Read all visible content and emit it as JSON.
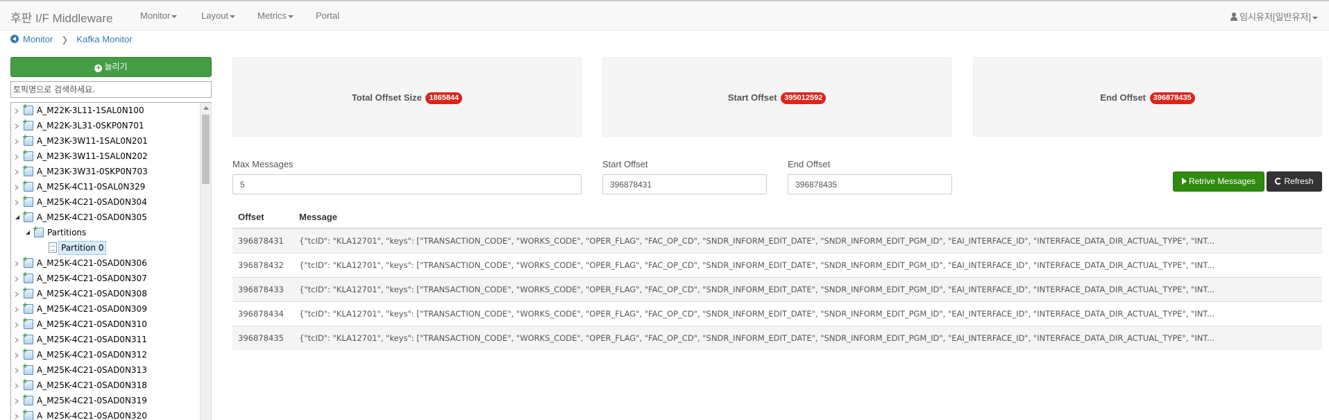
{
  "navbar": {
    "brand": "후판 I/F Middleware",
    "menu": [
      {
        "label": "Monitor",
        "dropdown": true
      },
      {
        "label": "Layout",
        "dropdown": true
      },
      {
        "label": "Metrics",
        "dropdown": true
      },
      {
        "label": "Portal",
        "dropdown": false
      }
    ],
    "user": "임시유저[일반유저]"
  },
  "breadcrumb": {
    "root": "Monitor",
    "current": "Kafka Monitor"
  },
  "sidebar": {
    "add_button": "늘리기",
    "search_placeholder": "토픽명으로 검색하세요.",
    "tree": [
      {
        "label": "A_M22K-3L11-1SAL0N100",
        "type": "topic",
        "expanded": false
      },
      {
        "label": "A_M22K-3L31-0SKP0N701",
        "type": "topic",
        "expanded": false
      },
      {
        "label": "A_M23K-3W11-1SAL0N201",
        "type": "topic",
        "expanded": false
      },
      {
        "label": "A_M23K-3W11-1SAL0N202",
        "type": "topic",
        "expanded": false
      },
      {
        "label": "A_M23K-3W31-0SKP0N703",
        "type": "topic",
        "expanded": false
      },
      {
        "label": "A_M25K-4C11-0SAL0N329",
        "type": "topic",
        "expanded": false
      },
      {
        "label": "A_M25K-4C21-0SAD0N304",
        "type": "topic",
        "expanded": false
      },
      {
        "label": "A_M25K-4C21-0SAD0N305",
        "type": "topic",
        "expanded": true
      },
      {
        "label": "Partitions",
        "type": "folder",
        "expanded": true
      },
      {
        "label": "Partition 0",
        "type": "partition",
        "selected": true
      },
      {
        "label": "A_M25K-4C21-0SAD0N306",
        "type": "topic",
        "expanded": false
      },
      {
        "label": "A_M25K-4C21-0SAD0N307",
        "type": "topic",
        "expanded": false
      },
      {
        "label": "A_M25K-4C21-0SAD0N308",
        "type": "topic",
        "expanded": false
      },
      {
        "label": "A_M25K-4C21-0SAD0N309",
        "type": "topic",
        "expanded": false
      },
      {
        "label": "A_M25K-4C21-0SAD0N310",
        "type": "topic",
        "expanded": false
      },
      {
        "label": "A_M25K-4C21-0SAD0N311",
        "type": "topic",
        "expanded": false
      },
      {
        "label": "A_M25K-4C21-0SAD0N312",
        "type": "topic",
        "expanded": false
      },
      {
        "label": "A_M25K-4C21-0SAD0N313",
        "type": "topic",
        "expanded": false
      },
      {
        "label": "A_M25K-4C21-0SAD0N318",
        "type": "topic",
        "expanded": false
      },
      {
        "label": "A_M25K-4C21-0SAD0N319",
        "type": "topic",
        "expanded": false
      },
      {
        "label": "A_M25K-4C21-0SAD0N320",
        "type": "topic",
        "expanded": false
      }
    ]
  },
  "summary": {
    "total_offset": {
      "label": "Total Offset Size",
      "value": "1865844"
    },
    "start_offset": {
      "label": "Start Offset",
      "value": "395012592"
    },
    "end_offset": {
      "label": "End Offset",
      "value": "396878435"
    }
  },
  "form": {
    "max_messages": {
      "label": "Max Messages",
      "value": "5"
    },
    "start_offset": {
      "label": "Start Offset",
      "value": "396878431"
    },
    "end_offset": {
      "label": "End Offset",
      "value": "396878435"
    },
    "retrieve_button": "Retrive Messages",
    "refresh_button": "Refresh"
  },
  "messages": {
    "columns": [
      "Offset",
      "Message"
    ],
    "rows": [
      {
        "offset": "396878431",
        "message": "{\"tcID\": \"KLA12701\", \"keys\": [\"TRANSACTION_CODE\", \"WORKS_CODE\", \"OPER_FLAG\", \"FAC_OP_CD\", \"SNDR_INFORM_EDIT_DATE\", \"SNDR_INFORM_EDIT_PGM_ID\", \"EAI_INTERFACE_ID\", \"INTERFACE_DATA_DIR_ACTUAL_TYPE\", \"INT..."
      },
      {
        "offset": "396878432",
        "message": "{\"tcID\": \"KLA12701\", \"keys\": [\"TRANSACTION_CODE\", \"WORKS_CODE\", \"OPER_FLAG\", \"FAC_OP_CD\", \"SNDR_INFORM_EDIT_DATE\", \"SNDR_INFORM_EDIT_PGM_ID\", \"EAI_INTERFACE_ID\", \"INTERFACE_DATA_DIR_ACTUAL_TYPE\", \"INT..."
      },
      {
        "offset": "396878433",
        "message": "{\"tcID\": \"KLA12701\", \"keys\": [\"TRANSACTION_CODE\", \"WORKS_CODE\", \"OPER_FLAG\", \"FAC_OP_CD\", \"SNDR_INFORM_EDIT_DATE\", \"SNDR_INFORM_EDIT_PGM_ID\", \"EAI_INTERFACE_ID\", \"INTERFACE_DATA_DIR_ACTUAL_TYPE\", \"INT..."
      },
      {
        "offset": "396878434",
        "message": "{\"tcID\": \"KLA12701\", \"keys\": [\"TRANSACTION_CODE\", \"WORKS_CODE\", \"OPER_FLAG\", \"FAC_OP_CD\", \"SNDR_INFORM_EDIT_DATE\", \"SNDR_INFORM_EDIT_PGM_ID\", \"EAI_INTERFACE_ID\", \"INTERFACE_DATA_DIR_ACTUAL_TYPE\", \"INT..."
      },
      {
        "offset": "396878435",
        "message": "{\"tcID\": \"KLA12701\", \"keys\": [\"TRANSACTION_CODE\", \"WORKS_CODE\", \"OPER_FLAG\", \"FAC_OP_CD\", \"SNDR_INFORM_EDIT_DATE\", \"SNDR_INFORM_EDIT_PGM_ID\", \"EAI_INTERFACE_ID\", \"INTERFACE_DATA_DIR_ACTUAL_TYPE\", \"INT..."
      }
    ]
  },
  "colors": {
    "add_button": "#449d44",
    "retrieve_button": "#2f8a10",
    "refresh_button": "#333333",
    "badge": "#d9251d",
    "link": "#337ab7"
  },
  "icons": {
    "user": "user-icon",
    "breadcrumb": "circle-arrow-left-icon",
    "add": "plus-circle-icon",
    "retrieve": "play-icon",
    "refresh": "refresh-icon",
    "topic": "topic-icon",
    "partition": "document-icon"
  }
}
